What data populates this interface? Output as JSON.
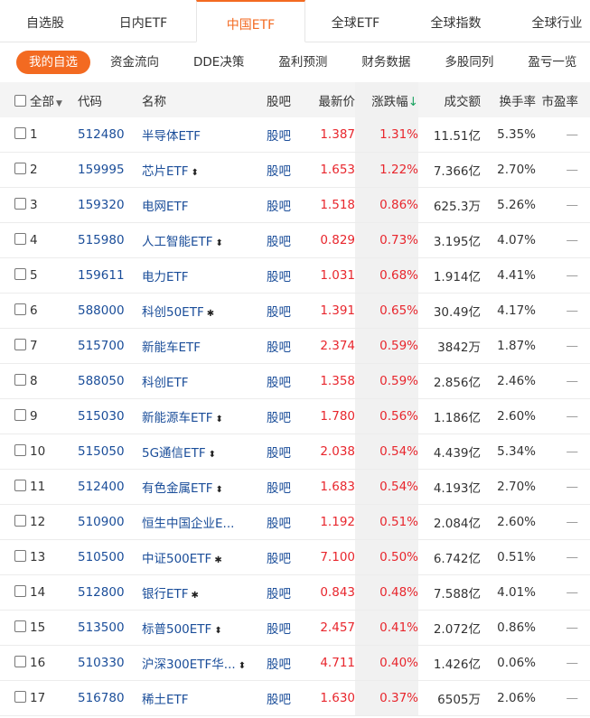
{
  "tabs": [
    "自选股",
    "日内ETF",
    "中国ETF",
    "全球ETF",
    "全球指数",
    "全球行业"
  ],
  "active_tab": 2,
  "subnav": [
    "我的自选",
    "资金流向",
    "DDE决策",
    "盈利预测",
    "财务数据",
    "多股同列",
    "盈亏一览"
  ],
  "table": {
    "headers": {
      "all": "全部",
      "code": "代码",
      "name": "名称",
      "bar": "股吧",
      "price": "最新价",
      "change": "涨跌幅",
      "sort_arrow": "↓",
      "volume": "成交额",
      "turnover": "换手率",
      "pe": "市盈率"
    },
    "rows": [
      {
        "idx": "1",
        "code": "512480",
        "name": "半导体ETF",
        "mark": "",
        "bar": "股吧",
        "price": "1.387",
        "change": "1.31%",
        "volume": "11.51亿",
        "turnover": "5.35%",
        "pe": "—"
      },
      {
        "idx": "2",
        "code": "159995",
        "name": "芯片ETF",
        "mark": "⬍",
        "bar": "股吧",
        "price": "1.653",
        "change": "1.22%",
        "volume": "7.366亿",
        "turnover": "2.70%",
        "pe": "—"
      },
      {
        "idx": "3",
        "code": "159320",
        "name": "电网ETF",
        "mark": "",
        "bar": "股吧",
        "price": "1.518",
        "change": "0.86%",
        "volume": "625.3万",
        "turnover": "5.26%",
        "pe": "—"
      },
      {
        "idx": "4",
        "code": "515980",
        "name": "人工智能ETF",
        "mark": "⬍",
        "bar": "股吧",
        "price": "0.829",
        "change": "0.73%",
        "volume": "3.195亿",
        "turnover": "4.07%",
        "pe": "—"
      },
      {
        "idx": "5",
        "code": "159611",
        "name": "电力ETF",
        "mark": "",
        "bar": "股吧",
        "price": "1.031",
        "change": "0.68%",
        "volume": "1.914亿",
        "turnover": "4.41%",
        "pe": "—"
      },
      {
        "idx": "6",
        "code": "588000",
        "name": "科创50ETF",
        "mark": "✱",
        "bar": "股吧",
        "price": "1.391",
        "change": "0.65%",
        "volume": "30.49亿",
        "turnover": "4.17%",
        "pe": "—"
      },
      {
        "idx": "7",
        "code": "515700",
        "name": "新能车ETF",
        "mark": "",
        "bar": "股吧",
        "price": "2.374",
        "change": "0.59%",
        "volume": "3842万",
        "turnover": "1.87%",
        "pe": "—"
      },
      {
        "idx": "8",
        "code": "588050",
        "name": "科创ETF",
        "mark": "",
        "bar": "股吧",
        "price": "1.358",
        "change": "0.59%",
        "volume": "2.856亿",
        "turnover": "2.46%",
        "pe": "—"
      },
      {
        "idx": "9",
        "code": "515030",
        "name": "新能源车ETF",
        "mark": "⬍",
        "bar": "股吧",
        "price": "1.780",
        "change": "0.56%",
        "volume": "1.186亿",
        "turnover": "2.60%",
        "pe": "—"
      },
      {
        "idx": "10",
        "code": "515050",
        "name": "5G通信ETF",
        "mark": "⬍",
        "bar": "股吧",
        "price": "2.038",
        "change": "0.54%",
        "volume": "4.439亿",
        "turnover": "5.34%",
        "pe": "—"
      },
      {
        "idx": "11",
        "code": "512400",
        "name": "有色金属ETF",
        "mark": "⬍",
        "bar": "股吧",
        "price": "1.683",
        "change": "0.54%",
        "volume": "4.193亿",
        "turnover": "2.70%",
        "pe": "—"
      },
      {
        "idx": "12",
        "code": "510900",
        "name": "恒生中国企业E...",
        "mark": "",
        "bar": "股吧",
        "price": "1.192",
        "change": "0.51%",
        "volume": "2.084亿",
        "turnover": "2.60%",
        "pe": "—"
      },
      {
        "idx": "13",
        "code": "510500",
        "name": "中证500ETF",
        "mark": "✱",
        "bar": "股吧",
        "price": "7.100",
        "change": "0.50%",
        "volume": "6.742亿",
        "turnover": "0.51%",
        "pe": "—"
      },
      {
        "idx": "14",
        "code": "512800",
        "name": "银行ETF",
        "mark": "✱",
        "bar": "股吧",
        "price": "0.843",
        "change": "0.48%",
        "volume": "7.588亿",
        "turnover": "4.01%",
        "pe": "—"
      },
      {
        "idx": "15",
        "code": "513500",
        "name": "标普500ETF",
        "mark": "⬍",
        "bar": "股吧",
        "price": "2.457",
        "change": "0.41%",
        "volume": "2.072亿",
        "turnover": "0.86%",
        "pe": "—"
      },
      {
        "idx": "16",
        "code": "510330",
        "name": "沪深300ETF华...",
        "mark": "⬍",
        "bar": "股吧",
        "price": "4.711",
        "change": "0.40%",
        "volume": "1.426亿",
        "turnover": "0.06%",
        "pe": "—"
      },
      {
        "idx": "17",
        "code": "516780",
        "name": "稀土ETF",
        "mark": "",
        "bar": "股吧",
        "price": "1.630",
        "change": "0.37%",
        "volume": "6505万",
        "turnover": "2.06%",
        "pe": "—"
      }
    ]
  }
}
